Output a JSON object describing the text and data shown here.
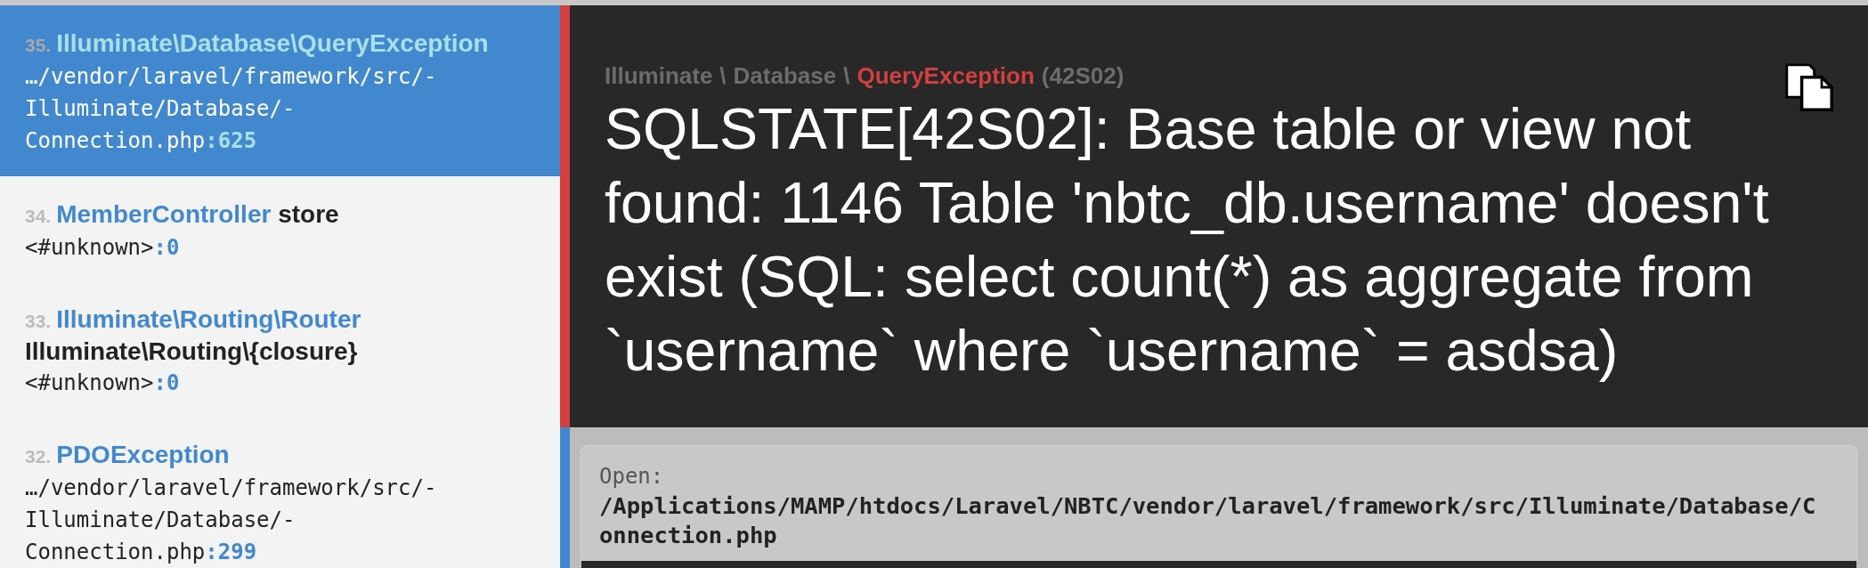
{
  "frames": [
    {
      "index": "35.",
      "class": "Illuminate\\Database\\QueryException",
      "file": [
        "…/vendor/laravel/framework/src/-",
        "Illuminate/Database/-",
        "Connection.php"
      ],
      "line": ":625",
      "selected": true
    },
    {
      "index": "34.",
      "class": "MemberController",
      "function": "store",
      "file": [
        "<#unknown>"
      ],
      "line": ":0",
      "selected": false
    },
    {
      "index": "33.",
      "class": "Illuminate\\Routing\\Router",
      "function": "Illuminate\\Routing\\{closure}",
      "file": [
        "<#unknown>"
      ],
      "line": ":0",
      "selected": false
    },
    {
      "index": "32.",
      "class": "PDOException",
      "file": [
        "…/vendor/laravel/framework/src/-",
        "Illuminate/Database/-",
        "Connection.php"
      ],
      "line": ":299",
      "selected": false
    }
  ],
  "exception": {
    "namespace": [
      "Illuminate",
      "Database"
    ],
    "separator": "\\",
    "class": "QueryException",
    "code": "(42S02)",
    "message": "SQLSTATE[42S02]: Base table or view not found: 1146 Table 'nbtc_db.username' doesn't exist (SQL: select count(*) as aggregate from `username` where `username` = asdsa)"
  },
  "open_file": {
    "label": "Open:",
    "path": "/Applications/MAMP/htdocs/Laravel/NBTC/vendor/laravel/framework/src/Illuminate/Database/Connection.php"
  }
}
